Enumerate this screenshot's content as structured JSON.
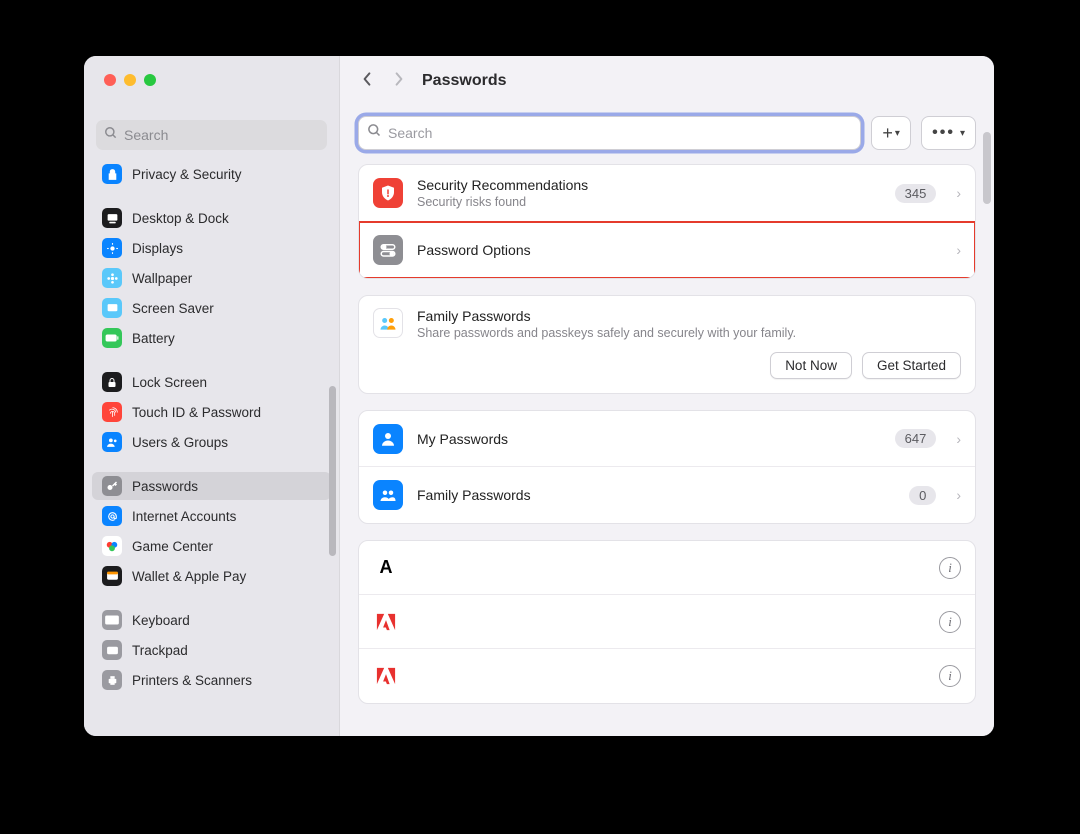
{
  "window": {
    "title": "Passwords"
  },
  "sidebar": {
    "search_placeholder": "Search",
    "items": [
      {
        "label": "Privacy & Security",
        "icon": "hand-privacy",
        "bg": "#0a84ff"
      },
      {
        "spacer": true
      },
      {
        "label": "Desktop & Dock",
        "icon": "dock",
        "bg": "#1c1c1e"
      },
      {
        "label": "Displays",
        "icon": "sun",
        "bg": "#0a84ff"
      },
      {
        "label": "Wallpaper",
        "icon": "flower",
        "bg": "#5ac8fa"
      },
      {
        "label": "Screen Saver",
        "icon": "screensaver",
        "bg": "#5ac8fa"
      },
      {
        "label": "Battery",
        "icon": "battery",
        "bg": "#34c759"
      },
      {
        "spacer": true
      },
      {
        "label": "Lock Screen",
        "icon": "lock",
        "bg": "#1c1c1e"
      },
      {
        "label": "Touch ID & Password",
        "icon": "fingerprint",
        "bg": "#ff453a"
      },
      {
        "label": "Users & Groups",
        "icon": "users",
        "bg": "#0a84ff"
      },
      {
        "spacer": true
      },
      {
        "label": "Passwords",
        "icon": "key",
        "bg": "#8e8e93",
        "selected": true
      },
      {
        "label": "Internet Accounts",
        "icon": "at",
        "bg": "#0a84ff"
      },
      {
        "label": "Game Center",
        "icon": "gamecenter",
        "bg": "#ffffff"
      },
      {
        "label": "Wallet & Apple Pay",
        "icon": "wallet",
        "bg": "#1c1c1e"
      },
      {
        "spacer": true
      },
      {
        "label": "Keyboard",
        "icon": "keyboard",
        "bg": "#9a9aa0"
      },
      {
        "label": "Trackpad",
        "icon": "trackpad",
        "bg": "#9a9aa0"
      },
      {
        "label": "Printers & Scanners",
        "icon": "printer",
        "bg": "#9a9aa0"
      }
    ]
  },
  "main": {
    "search_placeholder": "Search",
    "sections": {
      "security_recommendations": {
        "title": "Security Recommendations",
        "subtitle": "Security risks found",
        "count": "345"
      },
      "password_options": {
        "title": "Password Options"
      },
      "family": {
        "title": "Family Passwords",
        "subtitle": "Share passwords and passkeys safely and securely with your family.",
        "not_now": "Not Now",
        "get_started": "Get Started"
      },
      "my_passwords": {
        "title": "My Passwords",
        "count": "647"
      },
      "family_passwords": {
        "title": "Family Passwords",
        "count": "0"
      }
    },
    "password_entries": [
      {
        "glyph": "A",
        "color": "#000000"
      },
      {
        "glyph": "A",
        "color": "#e8312f",
        "adobe": true
      },
      {
        "glyph": "A",
        "color": "#e8312f",
        "adobe": true
      }
    ]
  }
}
